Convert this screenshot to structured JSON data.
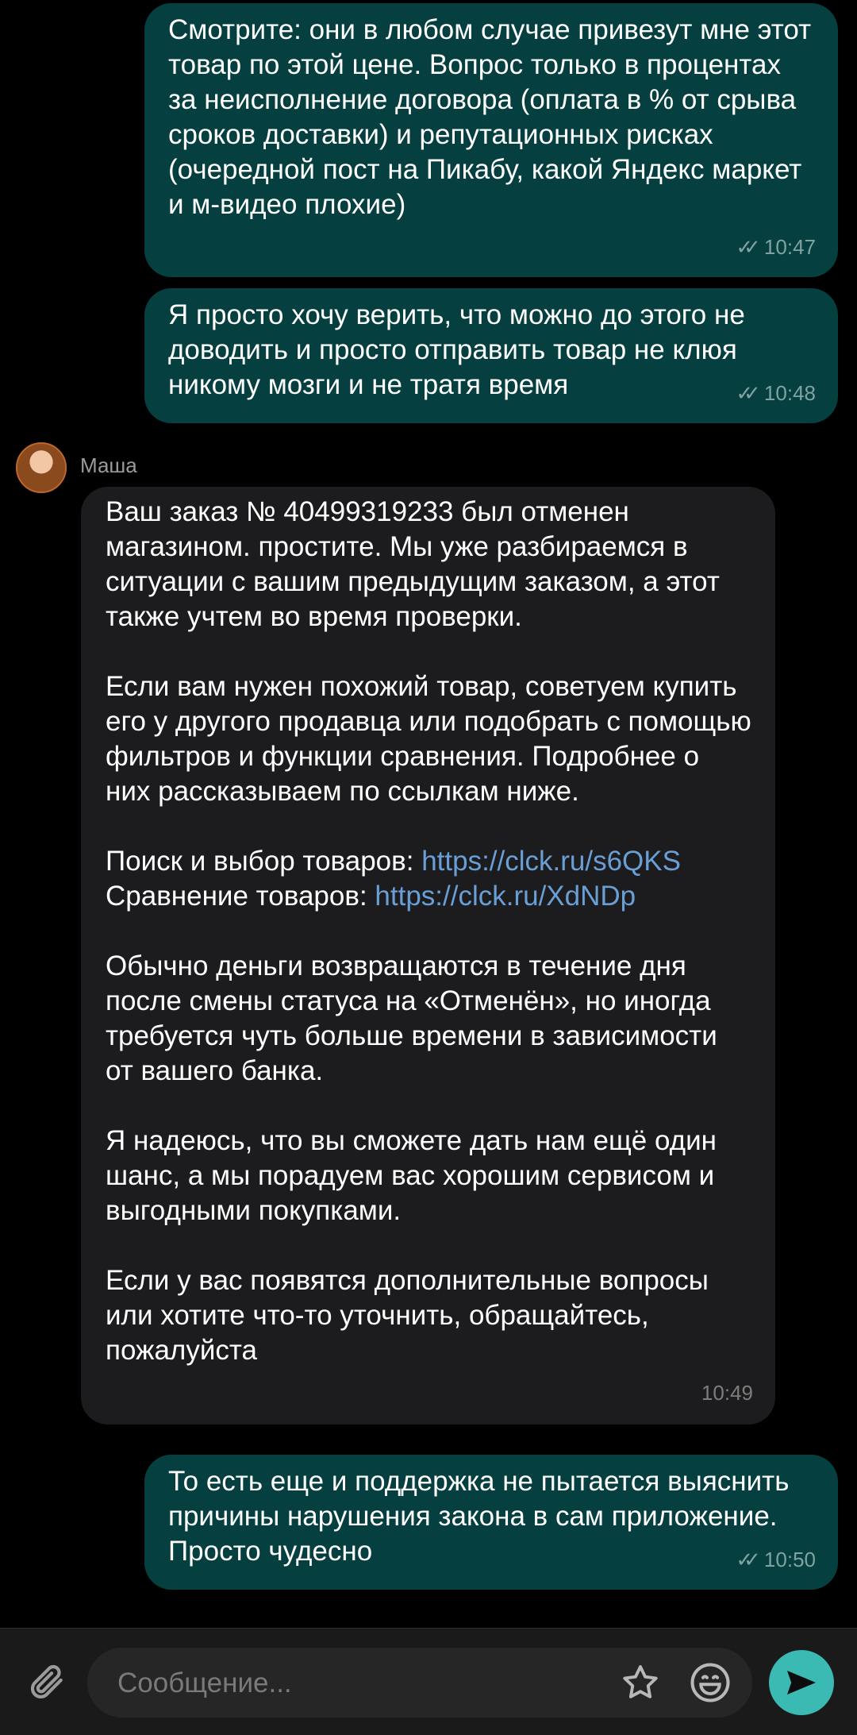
{
  "messages": [
    {
      "direction": "out",
      "text": "Смотрите: они в любом случае привезут мне этот товар по этой цене. Вопрос только в процентах за неисполнение договора (оплата в % от срыва сроков доставки) и репутационных рисках (очередной пост на Пикабу, какой Яндекс маркет и м-видео плохие)",
      "time": "10:47",
      "status": "✓✓"
    },
    {
      "direction": "out",
      "text": "Я просто хочу верить, что можно до этого не доводить и просто отправить товар не клюя никому мозги и не тратя время",
      "time": "10:48",
      "status": "✓✓"
    }
  ],
  "incoming": {
    "sender": "Маша",
    "p1": "Ваш заказ № 40499319233 был отменен магазином. простите. Мы уже разбираемся в ситуации с вашим предыдущим заказом, а этот также учтем во время проверки.",
    "p2": "Если вам нужен похожий товар, советуем купить его у другого продавца или подобрать с помощью фильтров и функции сравнения. Подробнее о них рассказываем по ссылкам ниже.",
    "search_label": "Поиск и выбор товаров: ",
    "search_link": "https://clck.ru/s6QKS",
    "compare_label": "Сравнение товаров: ",
    "compare_link": "https://clck.ru/XdNDp",
    "p4": "Обычно деньги возвращаются в течение дня после смены статуса на «Отменён», но иногда требуется чуть больше времени в зависимости от вашего банка.",
    "p5": "Я надеюсь, что вы сможете дать нам ещё один шанс, а мы порадуем вас хорошим сервисом и выгодными покупками.",
    "p6": "Если у вас появятся дополнительные вопросы или хотите что-то уточнить, обращайтесь, пожалуйста",
    "time": "10:49"
  },
  "last_message": {
    "direction": "out",
    "text": "То есть еще и поддержка не пытается выяснить причины нарушения закона в сам приложение. Просто чудесно",
    "time": "10:50",
    "status": "✓✓"
  },
  "composer": {
    "placeholder": "Сообщение...",
    "attach_icon": "paperclip-icon",
    "star_icon": "star-icon",
    "emoji_icon": "emoji-icon",
    "send_icon": "send-icon"
  },
  "colors": {
    "background": "#000000",
    "outgoing_bubble": "#063f3f",
    "incoming_bubble": "#1c1c1e",
    "link": "#6a9fd6",
    "send_button": "#3bb9b3"
  }
}
